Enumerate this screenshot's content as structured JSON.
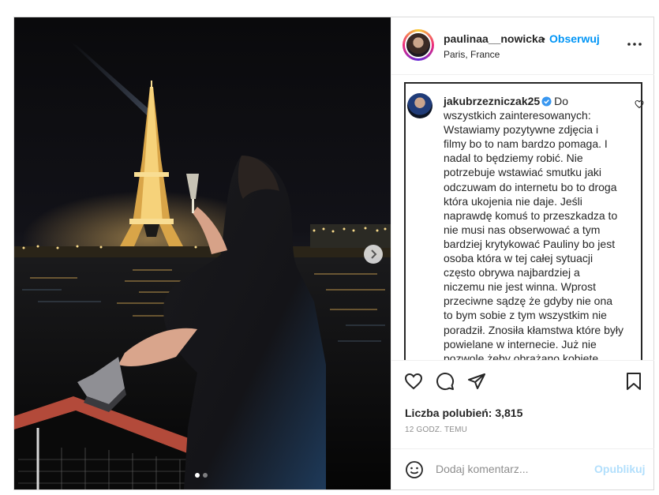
{
  "post": {
    "username": "paulinaa__nowicka",
    "separator": "•",
    "follow_label": "Obserwuj",
    "location": "Paris, France",
    "more_icon": "more-horizontal-icon"
  },
  "comment": {
    "username": "jakubrzezniczak25",
    "verified": true,
    "text": "Do wszystkich zainteresowanych: Wstawiamy pozytywne zdjęcia i filmy bo to nam bardzo pomaga. I nadal to będziemy robić. Nie potrzebuje wstawiać smutku jaki odczuwam do internetu bo to droga która ukojenia nie daje. Jeśli naprawdę komuś to przeszkadza to nie musi nas obserwować a tym bardziej krytykować Pauliny bo jest osoba która w tej całej sytuacji często obrywa najbardziej a niczemu nie jest winna. Wprost przeciwne sądzę że gdyby nie ona to bym sobie z tym wszystkim nie poradził. Znosiła kłamstwa które były powielane w internecie. Już nie pozwolę żeby obrażano kobietę"
  },
  "carousel": {
    "total": 2,
    "current": 1
  },
  "actions": {
    "likes_text": "Liczba polubień: 3,815",
    "time": "12 GODZ. TEMU"
  },
  "add_comment": {
    "placeholder": "Dodaj komentarz...",
    "publish_label": "Opublikuj"
  },
  "colors": {
    "follow": "#0095f6",
    "publish_disabled": "#b2dffc",
    "verified": "#3897f0"
  }
}
